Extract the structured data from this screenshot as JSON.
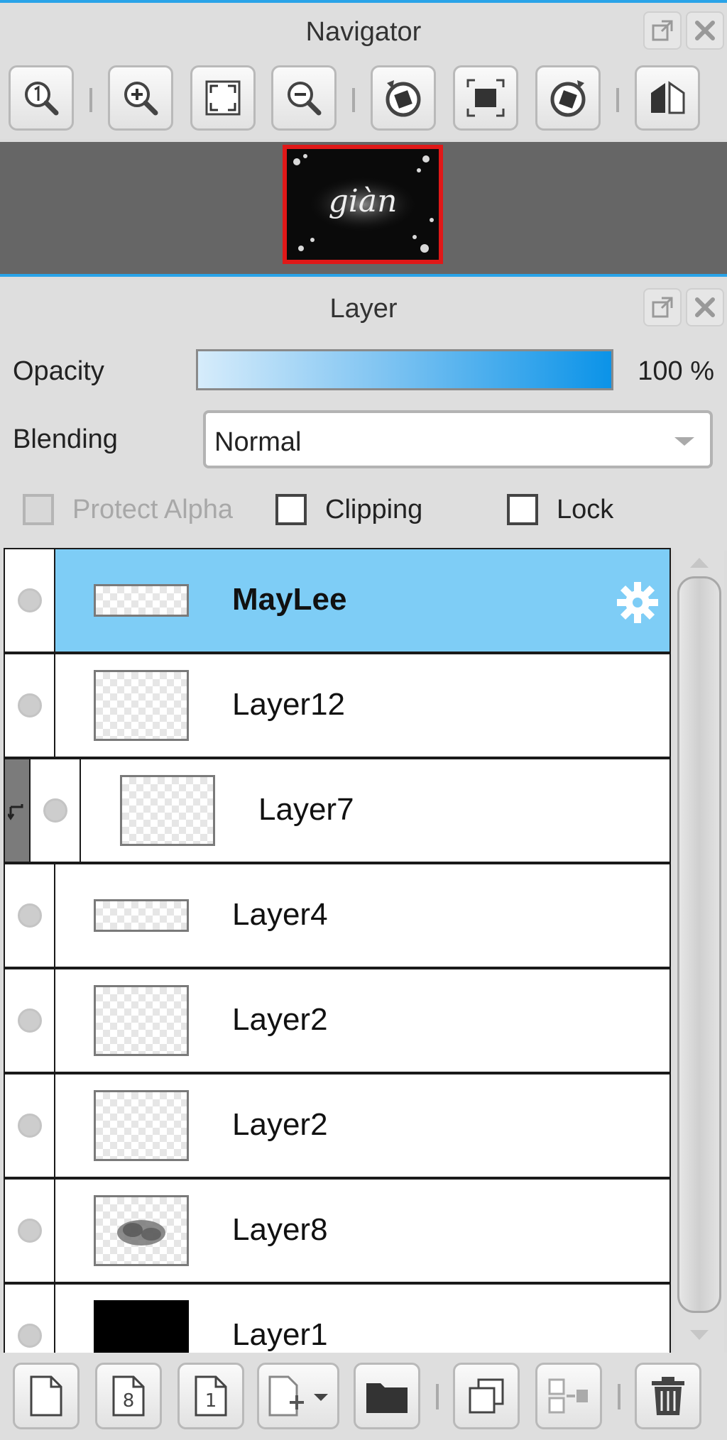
{
  "navigator": {
    "title": "Navigator",
    "toolbar_icons": [
      "zoom-actual-icon",
      "zoom-in-icon",
      "fit-window-icon",
      "zoom-out-icon",
      "rotate-left-icon",
      "fit-canvas-icon",
      "rotate-right-icon",
      "flip-horizontal-icon"
    ],
    "preview_caption": "giàn"
  },
  "layer_panel": {
    "title": "Layer",
    "opacity_label": "Opacity",
    "opacity_value": "100 %",
    "opacity_level": 1.0,
    "blending_label": "Blending",
    "blending_value": "Normal",
    "protect_alpha_label": "Protect Alpha",
    "clipping_label": "Clipping",
    "lock_label": "Lock",
    "layers": [
      {
        "name": "MayLee",
        "selected": true,
        "thumb": "wide",
        "clipped": false
      },
      {
        "name": "Layer12",
        "selected": false,
        "thumb": "checker",
        "clipped": false
      },
      {
        "name": "Layer7",
        "selected": false,
        "thumb": "checker",
        "clipped": true
      },
      {
        "name": "Layer4",
        "selected": false,
        "thumb": "wide",
        "clipped": false
      },
      {
        "name": "Layer2",
        "selected": false,
        "thumb": "checker",
        "clipped": false
      },
      {
        "name": "Layer2",
        "selected": false,
        "thumb": "checker",
        "clipped": false
      },
      {
        "name": "Layer8",
        "selected": false,
        "thumb": "smudge",
        "clipped": false
      },
      {
        "name": "Layer1",
        "selected": false,
        "thumb": "black",
        "clipped": false
      }
    ],
    "bottom_icons": [
      "new-layer-icon",
      "new-8bit-layer-icon",
      "new-1bit-layer-icon",
      "add-layer-menu-icon",
      "new-folder-icon",
      "duplicate-layer-icon",
      "merge-down-icon",
      "delete-layer-icon"
    ],
    "bottom_labels": {
      "eight": "8",
      "one": "1"
    }
  },
  "colors": {
    "accent": "#29a3e8",
    "selected_row": "#7ecdf6",
    "close_red": "#e01818"
  }
}
